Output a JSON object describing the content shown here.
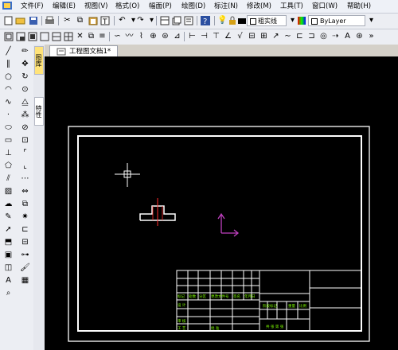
{
  "menu": [
    "文件(F)",
    "编辑(E)",
    "视图(V)",
    "格式(O)",
    "幅面(P)",
    "绘图(D)",
    "标注(N)",
    "修改(M)",
    "工具(T)",
    "窗口(W)",
    "帮助(H)"
  ],
  "toolbar1": {
    "linetype_label": "粗实线",
    "layer_label": "ByLayer"
  },
  "vtabs": [
    "图库",
    "特性"
  ],
  "document_tab": "工程图文档1*",
  "title_block": {
    "designer_label": "设 计",
    "checker_label": "审 核",
    "process_label": "工 艺",
    "approve_label": "批 准",
    "mark_label": "标记",
    "count_label": "处数",
    "zone_label": "分区",
    "change_doc_label": "更改文件号",
    "signature_label": "签名",
    "date_label": "年月日",
    "stage_label": "阶段标记",
    "weight_label": "重量",
    "scale_label": "比例",
    "sheet_label": "共 张 第 张"
  },
  "colors": {
    "canvas_bg": "#000000",
    "drawing_line": "#ffffff",
    "part_centerline": "#ff2a2a",
    "ucs_axis": "#c040c0",
    "title_text": "#7fff00"
  }
}
